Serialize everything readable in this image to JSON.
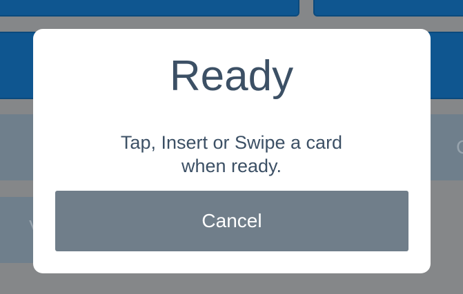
{
  "background": {
    "right_partial_label": "C",
    "left_partial_label": "V"
  },
  "modal": {
    "title": "Ready",
    "message": "Tap, Insert or Swipe a card\nwhen ready.",
    "cancel_label": "Cancel"
  }
}
